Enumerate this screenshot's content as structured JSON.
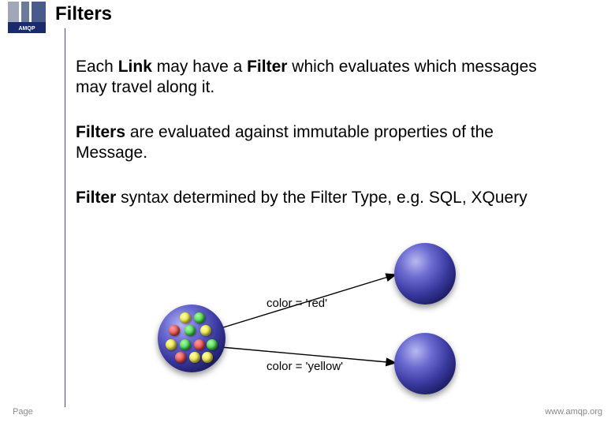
{
  "logo_text": "AMQP",
  "title": "Filters",
  "paragraphs": {
    "p1_a": "Each ",
    "p1_b": "Link",
    "p1_c": " may have a ",
    "p1_d": "Filter",
    "p1_e": " which evaluates which messages may travel along it.",
    "p2_a": "Filters",
    "p2_b": " are evaluated against immutable properties of the Message.",
    "p3_a": "Filter",
    "p3_b": " syntax determined by the Filter Type, e.g. SQL, XQuery"
  },
  "diagram": {
    "filter1": "color = 'red'",
    "filter2": "color = 'yellow'"
  },
  "footer": {
    "left": "Page",
    "right": "www.amqp.org"
  }
}
